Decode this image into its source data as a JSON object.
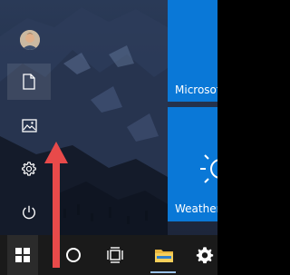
{
  "start_menu": {
    "rail": {
      "items": [
        {
          "name": "user-avatar",
          "icon": "avatar"
        },
        {
          "name": "documents",
          "icon": "document-icon"
        },
        {
          "name": "pictures",
          "icon": "pictures-icon"
        },
        {
          "name": "settings",
          "icon": "gear-icon"
        },
        {
          "name": "power",
          "icon": "power-icon"
        }
      ]
    },
    "tiles": [
      {
        "label": "Microsof",
        "color": "#0a78d7"
      },
      {
        "label": "Weather",
        "color": "#0a78d7",
        "icon": "sun-icon"
      }
    ]
  },
  "taskbar": {
    "items": [
      {
        "name": "start",
        "icon": "windows-logo-icon"
      },
      {
        "name": "cortana",
        "icon": "cortana-circle-icon"
      },
      {
        "name": "task-view",
        "icon": "task-view-icon"
      },
      {
        "name": "file-explorer",
        "icon": "folder-icon"
      },
      {
        "name": "settings",
        "icon": "gear-icon"
      }
    ],
    "background": "#1a1a1a"
  },
  "annotation": {
    "icon": "red-arrow-up-icon",
    "color": "#e84a4a"
  }
}
